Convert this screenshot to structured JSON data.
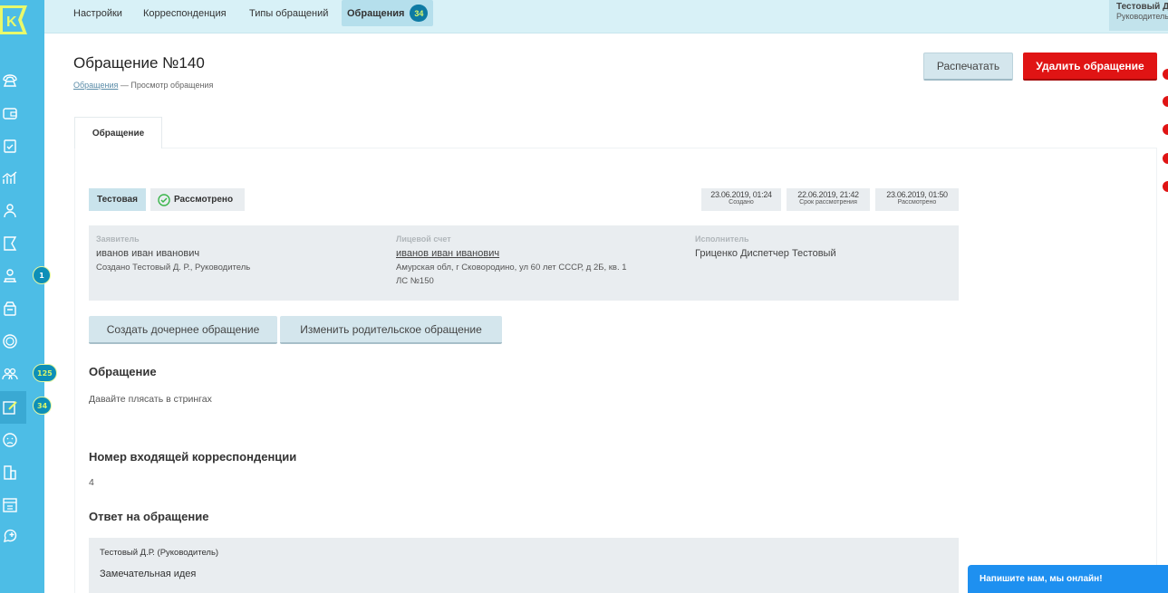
{
  "topnav": {
    "items": [
      {
        "label": "Настройки"
      },
      {
        "label": "Корреспонденция"
      },
      {
        "label": "Типы обращений"
      },
      {
        "label": "Обращения",
        "badge": "34"
      }
    ]
  },
  "user": {
    "name": "Тестовый Д. Р.",
    "role": "Руководитель, Doctor"
  },
  "sidebar": {
    "logo": "K",
    "badges": {
      "item7": "1",
      "item10": "125",
      "item11": "34"
    },
    "icons": [
      "phone-icon",
      "wallet-icon",
      "clipboard-icon",
      "chart-icon",
      "users-icon",
      "flag-icon",
      "operator-icon",
      "archive-icon",
      "coin-icon",
      "group-icon",
      "edit-icon",
      "sad-face-icon",
      "building-icon",
      "dashboard-icon",
      "chat-plus-icon"
    ]
  },
  "page": {
    "title": "Обращение №140",
    "breadcrumb_link": "Обращения",
    "breadcrumb_sep": " — ",
    "breadcrumb_current": "Просмотр обращения",
    "print_label": "Распечатать",
    "delete_label": "Удалить обращение"
  },
  "tab": {
    "label": "Обращение"
  },
  "tags": {
    "type": "Тестовая",
    "status": "Рассмотрено"
  },
  "dates": [
    {
      "value": "23.06.2019, 01:24",
      "label": "Создано"
    },
    {
      "value": "22.06.2019, 21:42",
      "label": "Срок рассмотрения"
    },
    {
      "value": "23.06.2019, 01:50",
      "label": "Рассмотрено"
    }
  ],
  "info": {
    "applicant_label": "Заявитель",
    "applicant_name": "иванов иван иванович",
    "applicant_created": "Создано Тестовый Д. Р., Руководитель",
    "account_label": "Лицевой счет",
    "account_name": "иванов иван иванович",
    "account_address": "Амурская обл, г Сковородино, ул 60 лет СССР, д 2Б, кв. 1",
    "account_number": "ЛС №150",
    "executor_label": "Исполнитель",
    "executor_name": "Гриценко Диспетчер Тестовый"
  },
  "actions": {
    "create_child": "Создать дочернее обращение",
    "change_parent": "Изменить родительское обращение"
  },
  "appeal": {
    "heading": "Обращение",
    "text": "Давайте плясать в стрингах"
  },
  "incoming": {
    "heading": "Номер входящей корреспонденции",
    "value": "4"
  },
  "answer": {
    "heading": "Ответ на обращение",
    "author": "Тестовый Д.Р. (Руководитель)",
    "text": "Замечательная идея"
  },
  "chat": {
    "label": "Напишите нам, мы онлайн!"
  },
  "colors": {
    "sidebar": "#4dbde6",
    "topbar": "#d8f1f7",
    "danger": "#e01414",
    "chat": "#1e90f0"
  }
}
